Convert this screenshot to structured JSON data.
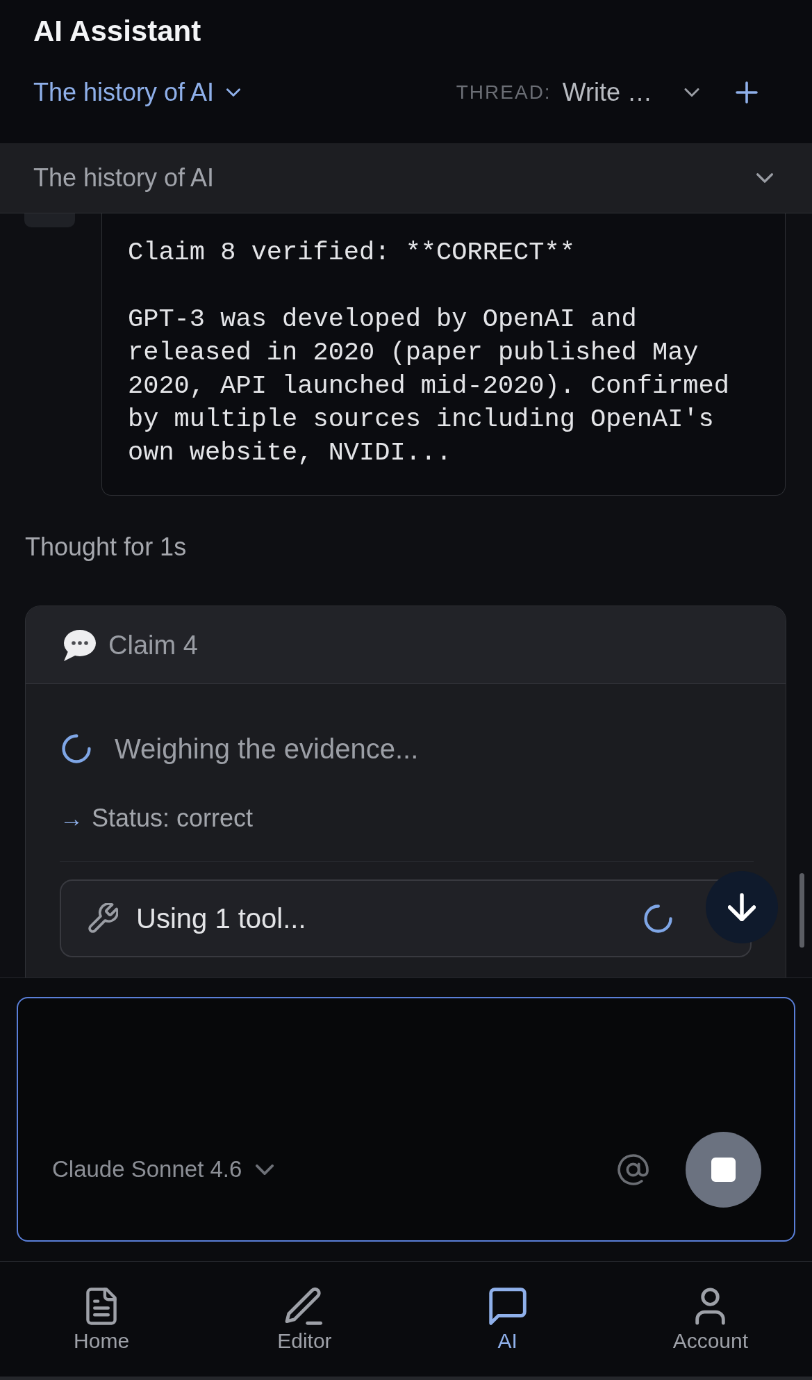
{
  "header": {
    "title": "AI Assistant",
    "document_selector": {
      "label": "The history of AI"
    },
    "thread": {
      "label": "THREAD:",
      "value": "Write …"
    }
  },
  "document_bar": {
    "title": "The history of AI",
    "expanded": false
  },
  "messages": [
    {
      "kind": "tool_output",
      "text": "Claim 8 verified: **CORRECT**\n\nGPT-3 was developed by OpenAI and released in 2020 (paper published May 2020, API launched mid-2020). Confirmed by multiple sources including OpenAI's own website, NVIDI..."
    },
    {
      "kind": "thought",
      "text": "Thought for 1s"
    },
    {
      "kind": "claim",
      "title": "Claim 4",
      "progress": "Weighing the evidence...",
      "status_arrow": "→",
      "status": "Status: correct",
      "tool_call": {
        "label": "Using 1 tool..."
      }
    }
  ],
  "composer": {
    "model": "Claude Sonnet 4.6"
  },
  "nav": [
    {
      "label": "Home",
      "selected": false
    },
    {
      "label": "Editor",
      "selected": false
    },
    {
      "label": "AI",
      "selected": true
    },
    {
      "label": "Account",
      "selected": false
    }
  ]
}
